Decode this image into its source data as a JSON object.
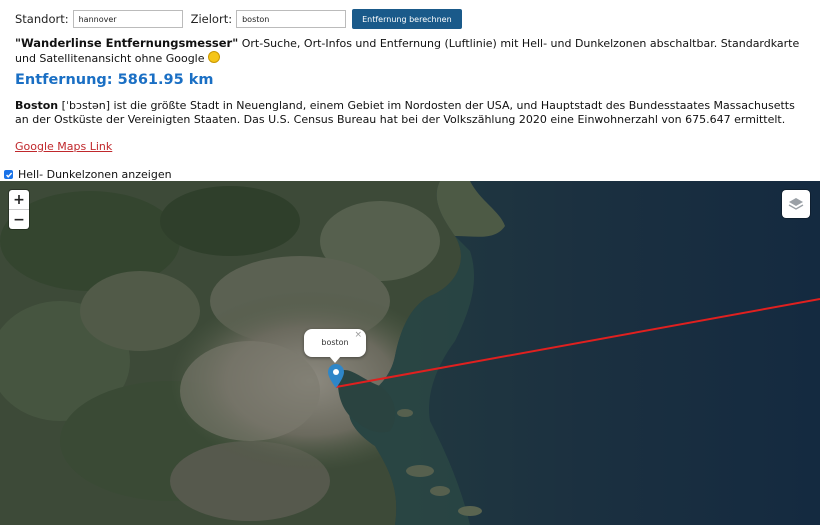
{
  "form": {
    "standort_label": "Standort:",
    "standort_value": "hannover",
    "zielort_label": "Zielort:",
    "zielort_value": "boston",
    "button_label": "Entfernung berechnen"
  },
  "intro": {
    "title": "\"Wanderlinse Entfernungsmesser\"",
    "text": " Ort-Suche, Ort-Infos und Entfernung (Luftlinie) mit Hell- und Dunkelzonen abschaltbar. Standardkarte und Satellitenansicht ohne Google ",
    "emoji_icon": "smiley-icon"
  },
  "distance": "Entfernung: 5861.95 km",
  "description": {
    "city": "Boston",
    "text": " [ˈbɔstən] ist die größte Stadt in Neuengland, einem Gebiet im Nordosten der USA, und Hauptstadt des Bundesstaates Massachusetts an der Ostküste der Vereinigten Staaten. Das U.S. Census Bureau hat bei der Volkszählung 2020 eine Einwohnerzahl von 675.647 ermittelt."
  },
  "link": {
    "label": "Google Maps Link"
  },
  "toggle": {
    "label": "Hell- Dunkelzonen anzeigen",
    "checked": true
  },
  "map": {
    "zoom_in": "+",
    "zoom_out": "−",
    "popup_text": "boston",
    "popup_close": "×",
    "route_color": "#e0201f",
    "marker_color": "#2e86c8",
    "layers_icon": "layers-icon"
  }
}
